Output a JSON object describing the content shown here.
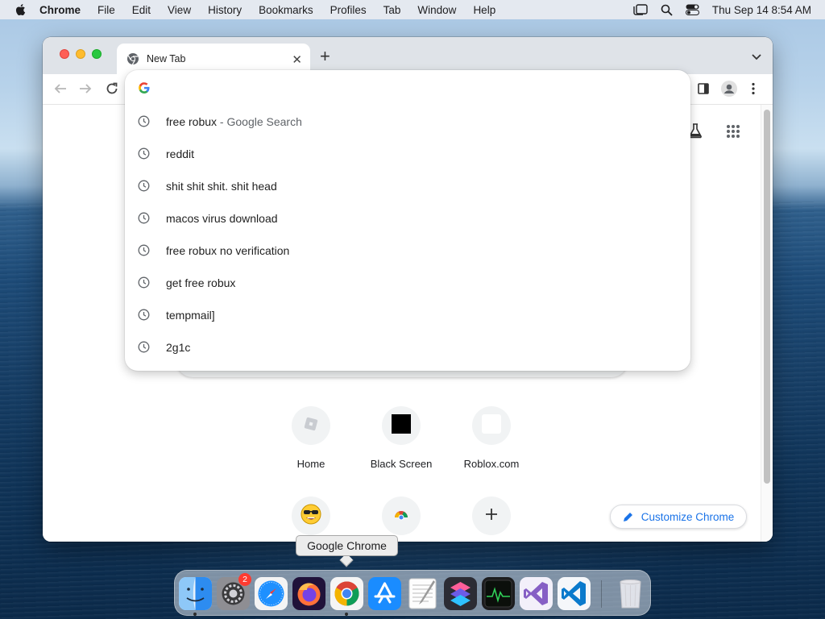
{
  "menubar": {
    "app_name": "Chrome",
    "items": [
      "File",
      "Edit",
      "View",
      "History",
      "Bookmarks",
      "Profiles",
      "Tab",
      "Window",
      "Help"
    ],
    "clock": "Thu Sep 14  8:54 AM"
  },
  "window": {
    "tab_title": "New Tab"
  },
  "omnibox": {
    "value": "",
    "suggestions": [
      {
        "text": "free robux",
        "sub": " - Google Search"
      },
      {
        "text": "reddit",
        "sub": ""
      },
      {
        "text": "shit shit shit. shit head",
        "sub": ""
      },
      {
        "text": "macos virus download",
        "sub": ""
      },
      {
        "text": "free robux no verification",
        "sub": ""
      },
      {
        "text": "get free robux",
        "sub": ""
      },
      {
        "text": "tempmail]",
        "sub": ""
      },
      {
        "text": "2g1c",
        "sub": ""
      }
    ]
  },
  "shortcuts": [
    {
      "label": "Home",
      "icon": "roblox-icon"
    },
    {
      "label": "Black Screen",
      "icon": "black-square-icon"
    },
    {
      "label": "Roblox.com",
      "icon": "blank-icon"
    },
    {
      "label": "",
      "icon": "sunglasses-emoji-icon"
    },
    {
      "label": "",
      "icon": "chrome-web-store-icon"
    },
    {
      "label": "",
      "icon": "plus-icon"
    }
  ],
  "customize": {
    "label": "Customize Chrome"
  },
  "tooltip": {
    "text": "Google Chrome"
  },
  "dock": {
    "settings_badge": "2",
    "apps": [
      "Finder",
      "System Settings",
      "Safari",
      "Firefox",
      "Google Chrome",
      "App Store",
      "TextEdit",
      "Shortcuts",
      "Activity Monitor",
      "Visual Studio",
      "Visual Studio Code",
      "Trash"
    ]
  },
  "colors": {
    "accent": "#1a73e8",
    "tooltip_bg": "#ececec"
  }
}
